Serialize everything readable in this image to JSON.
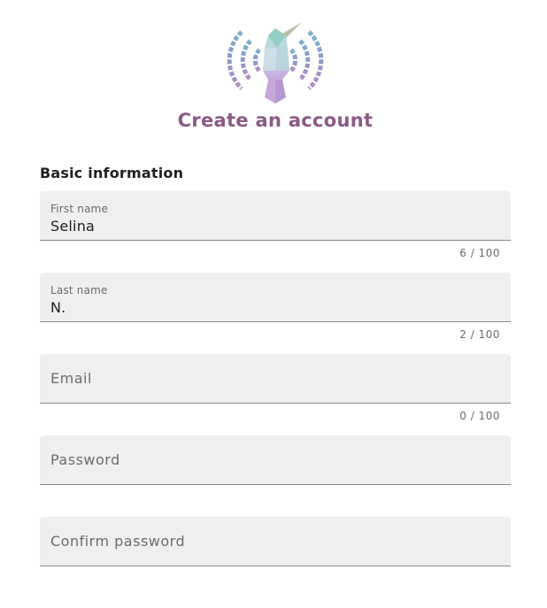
{
  "header": {
    "logo_icon": "hummingbird-signal-logo-icon",
    "title": "Create an account"
  },
  "form": {
    "section_heading": "Basic information",
    "first_name": {
      "label": "First name",
      "value": "Selina",
      "counter": "6 / 100"
    },
    "last_name": {
      "label": "Last name",
      "value": "N.",
      "counter": "2 / 100"
    },
    "email": {
      "placeholder": "Email",
      "counter": "0 / 100"
    },
    "password": {
      "placeholder": "Password"
    },
    "confirm_password": {
      "placeholder": "Confirm password"
    }
  },
  "colors": {
    "title": "#8b5a86",
    "field_background": "#efefef",
    "field_underline": "#8a8a8a"
  }
}
